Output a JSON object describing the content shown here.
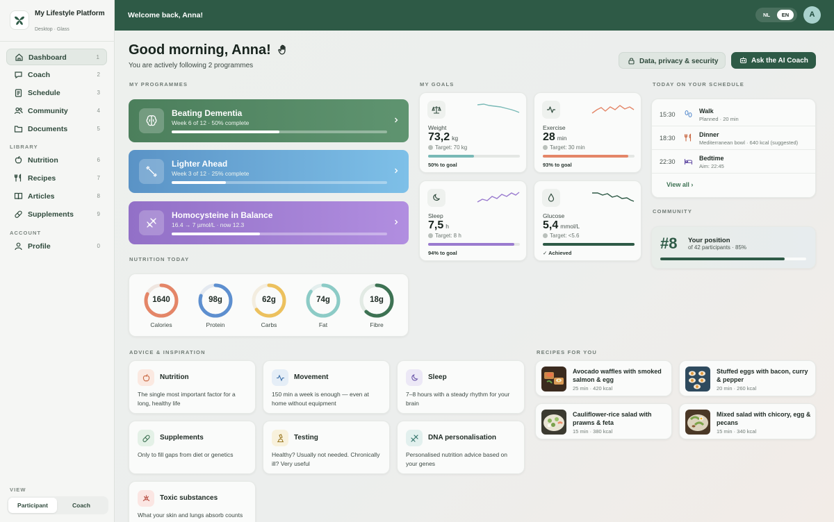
{
  "app": {
    "name": "My Lifestyle Platform",
    "subtitle": "Desktop · Glass"
  },
  "sidebar": {
    "items": [
      {
        "label": "Dashboard",
        "num": "1",
        "icon": "home-icon"
      },
      {
        "label": "Coach",
        "num": "2",
        "icon": "chat-icon"
      },
      {
        "label": "Schedule",
        "num": "3",
        "icon": "clipboard-icon"
      },
      {
        "label": "Community",
        "num": "4",
        "icon": "users-icon"
      },
      {
        "label": "Documents",
        "num": "5",
        "icon": "folder-icon"
      }
    ],
    "library_label": "LIBRARY",
    "library": [
      {
        "label": "Nutrition",
        "num": "6",
        "icon": "apple-icon"
      },
      {
        "label": "Recipes",
        "num": "7",
        "icon": "utensils-icon"
      },
      {
        "label": "Articles",
        "num": "8",
        "icon": "book-icon"
      },
      {
        "label": "Supplements",
        "num": "9",
        "icon": "pill-icon"
      }
    ],
    "account_label": "ACCOUNT",
    "account": [
      {
        "label": "Profile",
        "num": "0",
        "icon": "user-icon"
      }
    ],
    "view_label": "VIEW",
    "view_options": [
      "Participant",
      "Coach"
    ],
    "view_selected": "Participant"
  },
  "topbar": {
    "welcome": "Welcome back, Anna!",
    "lang": [
      "NL",
      "EN"
    ],
    "lang_selected": "EN",
    "avatar": "A"
  },
  "header": {
    "greeting": "Good morning, Anna!",
    "sub": "You are actively following 2 programmes",
    "privacy_button": "Data, privacy & security",
    "coach_button": "Ask the AI Coach"
  },
  "programmes": {
    "label": "MY PROGRAMMES",
    "items": [
      {
        "title": "Beating Dementia",
        "sub": "Week 6 of 12 · 50% complete",
        "progress": 0.5,
        "color": "#4f8460"
      },
      {
        "title": "Lighter Ahead",
        "sub": "Week 3 of 12 · 25% complete",
        "progress": 0.25,
        "color": "#5d9bc9"
      },
      {
        "title": "Homocysteine in Balance",
        "sub": "16.4 → 7 µmol/L · now 12.3",
        "progress": 0.41,
        "color": "#9b79cf"
      }
    ]
  },
  "goals": {
    "label": "MY GOALS",
    "items": [
      {
        "name": "Weight",
        "value": "73,2",
        "unit": "kg",
        "target": "Target: 70 kg",
        "pct": "50% to goal",
        "progress": 0.5,
        "color": "#78b9b6"
      },
      {
        "name": "Exercise",
        "value": "28",
        "unit": "min",
        "target": "Target: 30 min",
        "pct": "93% to goal",
        "progress": 0.93,
        "color": "#e48668"
      },
      {
        "name": "Sleep",
        "value": "7,5",
        "unit": "h",
        "target": "Target: 8 h",
        "pct": "94% to goal",
        "progress": 0.94,
        "color": "#9a7bcf"
      },
      {
        "name": "Glucose",
        "value": "5,4",
        "unit": "mmol/L",
        "target": "Target: <5.6",
        "pct": "✓ Achieved",
        "progress": 1.0,
        "color": "#2e5a46"
      }
    ]
  },
  "schedule": {
    "label": "TODAY ON YOUR SCHEDULE",
    "items": [
      {
        "time": "15:30",
        "title": "Walk",
        "sub": "Planned · 20 min"
      },
      {
        "time": "18:30",
        "title": "Dinner",
        "sub": "Mediterranean bowl · 640 kcal (suggested)"
      },
      {
        "time": "22:30",
        "title": "Bedtime",
        "sub": "Aim: 22:45"
      }
    ],
    "view_all": "View all ›"
  },
  "community": {
    "label": "COMMUNITY",
    "rank": "#8",
    "title": "Your position",
    "sub": "of 42 participants · 85%",
    "progress": 0.85
  },
  "nutrition": {
    "label": "NUTRITION TODAY",
    "items": [
      {
        "value": "1640",
        "label": "Calories",
        "progress": 0.82,
        "color": "#e48668"
      },
      {
        "value": "98g",
        "label": "Protein",
        "progress": 0.8,
        "color": "#5d8fcf"
      },
      {
        "value": "62g",
        "label": "Carbs",
        "progress": 0.65,
        "color": "#ecc15e"
      },
      {
        "value": "74g",
        "label": "Fat",
        "progress": 0.85,
        "color": "#8ccbc6"
      },
      {
        "value": "18g",
        "label": "Fibre",
        "progress": 0.62,
        "color": "#3d7253"
      }
    ]
  },
  "advice": {
    "label": "ADVICE & INSPIRATION",
    "items": [
      {
        "title": "Nutrition",
        "desc": "The single most important factor for a long, healthy life",
        "bg": "#fbe9e1",
        "color": "#c96a45"
      },
      {
        "title": "Movement",
        "desc": "150 min a week is enough — even at home without equipment",
        "bg": "#e5eef7",
        "color": "#3b6fa8"
      },
      {
        "title": "Sleep",
        "desc": "7–8 hours with a steady rhythm for your brain",
        "bg": "#ece8f6",
        "color": "#6a55a8"
      },
      {
        "title": "Supplements",
        "desc": "Only to fill gaps from diet or genetics",
        "bg": "#e4f1e7",
        "color": "#3d7253"
      },
      {
        "title": "Testing",
        "desc": "Healthy? Usually not needed. Chronically ill? Very useful",
        "bg": "#f8f1dc",
        "color": "#9c7a25"
      },
      {
        "title": "DNA personalisation",
        "desc": "Personalised nutrition advice based on your genes",
        "bg": "#e2f0ee",
        "color": "#2e6f66"
      },
      {
        "title": "Toxic substances",
        "desc": "What your skin and lungs absorb counts too",
        "bg": "#fbe6e3",
        "color": "#b4463a"
      }
    ]
  },
  "recipes": {
    "label": "RECIPES FOR YOU",
    "items": [
      {
        "title": "Avocado waffles with smoked salmon & egg",
        "meta": "25 min · 420 kcal"
      },
      {
        "title": "Stuffed eggs with bacon, curry & pepper",
        "meta": "20 min · 260 kcal"
      },
      {
        "title": "Cauliflower-rice salad with prawns & feta",
        "meta": "15 min · 380 kcal"
      },
      {
        "title": "Mixed salad with chicory, egg & pecans",
        "meta": "15 min · 340 kcal"
      }
    ]
  }
}
